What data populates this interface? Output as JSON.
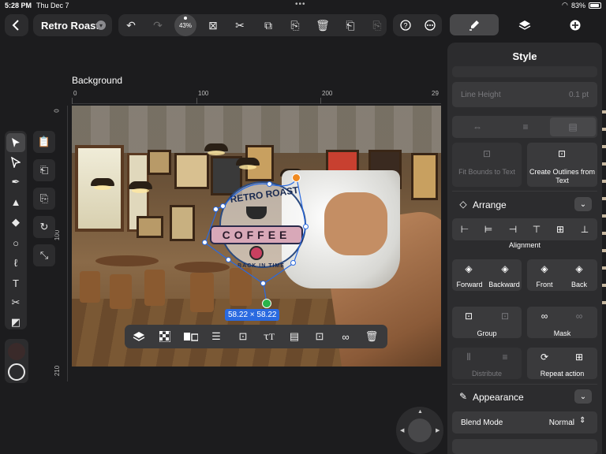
{
  "status_bar": {
    "time": "5:28 PM",
    "date": "Thu Dec 7",
    "battery": "83%"
  },
  "toolbar": {
    "document_title": "Retro Roast",
    "zoom_level": "43%",
    "icons": [
      "back-icon",
      "chevron-down-icon",
      "undo-icon",
      "redo-icon",
      "select-box-icon",
      "cut-icon",
      "copy-icon",
      "paste-icon",
      "trash-icon",
      "duplicate-icon",
      "paste-style-icon",
      "help-icon",
      "more-icon"
    ]
  },
  "panel_tabs": [
    "style-tab",
    "layers-tab",
    "add-tab"
  ],
  "canvas": {
    "background_label": "Background",
    "ruler_top_ticks": [
      "0",
      "100",
      "200",
      "29"
    ],
    "ruler_left_ticks": [
      "0",
      "100",
      "210"
    ],
    "selection_size": "58.22 × 58.22",
    "artwork": {
      "logo_title": "RETRO ROAST",
      "logo_main": "COFFEE",
      "logo_subtitle": "BACK IN TIME"
    }
  },
  "floating_toolbar": [
    "layers-icon",
    "checkerboard-icon",
    "flip-icon",
    "align-icon",
    "fit-bounds-icon",
    "text-on-path-icon",
    "notes-icon",
    "outline-icon",
    "mask-icon",
    "delete-icon"
  ],
  "left_tools": [
    "pointer-icon",
    "direct-select-icon",
    "pen-icon",
    "brush-icon",
    "fill-icon",
    "ellipse-icon",
    "lasso-icon",
    "text-icon",
    "scissors-icon",
    "eraser-icon"
  ],
  "left_tools_secondary": [
    "clipboard-icon",
    "copy-icon",
    "paste-icon",
    "rotate-icon",
    "scale-icon"
  ],
  "style_panel": {
    "title": "Style",
    "line_height_label": "Line Height",
    "line_height_value": "0.1 pt",
    "fit_bounds_label": "Fit Bounds to Text",
    "create_outlines_label": "Create Outlines from Text",
    "arrange_label": "Arrange",
    "alignment_label": "Alignment",
    "forward_label": "Forward",
    "backward_label": "Backward",
    "front_label": "Front",
    "back_label": "Back",
    "group_label": "Group",
    "mask_label": "Mask",
    "distribute_label": "Distribute",
    "repeat_action_label": "Repeat action",
    "appearance_label": "Appearance",
    "blend_mode_label": "Blend Mode",
    "blend_mode_value": "Normal"
  },
  "colors": {
    "accent": "#2a6ae0",
    "rotation_handle": "#f08a20",
    "move_handle": "#2ab44a",
    "panel_bg": "#2c2c2e"
  }
}
